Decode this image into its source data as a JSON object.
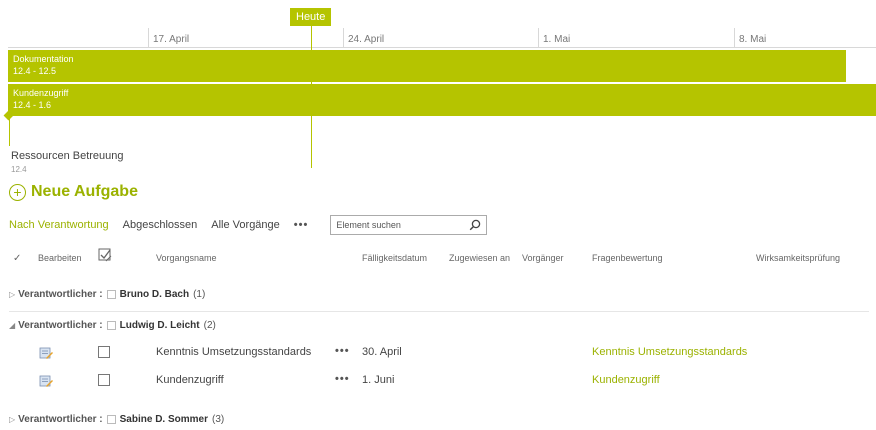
{
  "timeline": {
    "today_label": "Heute",
    "dates": [
      "17. April",
      "24. April",
      "1. Mai",
      "8. Mai"
    ],
    "bars": [
      {
        "name": "Dokumentation",
        "range": "12.4 - 12.5"
      },
      {
        "name": "Kundenzugriff",
        "range": "12.4 - 1.6"
      }
    ],
    "milestone": {
      "name": "Ressourcen Betreuung",
      "date": "12.4"
    },
    "accent_color": "#b5c400"
  },
  "new_task_label": "Neue Aufgabe",
  "views": {
    "tabs": [
      "Nach Verantwortung",
      "Abgeschlossen",
      "Alle Vorgänge"
    ],
    "more": "•••",
    "search_placeholder": "Element suchen"
  },
  "columns": {
    "check": "✓",
    "edit": "Bearbeiten",
    "name": "Vorgangsname",
    "due": "Fälligkeitsdatum",
    "assigned": "Zugewiesen an",
    "predecessor": "Vorgänger",
    "rating": "Fragenbewertung",
    "effectiveness": "Wirksamkeitsprüfung"
  },
  "groups": [
    {
      "label": "Verantwortlicher :",
      "name": "Bruno D. Bach",
      "count": "(1)",
      "expanded": false
    },
    {
      "label": "Verantwortlicher :",
      "name": "Ludwig D. Leicht",
      "count": "(2)",
      "expanded": true
    },
    {
      "label": "Verantwortlicher :",
      "name": "Sabine D. Sommer",
      "count": "(3)",
      "expanded": false
    }
  ],
  "rows": [
    {
      "name": "Kenntnis Umsetzungsstandards",
      "menu": "•••",
      "due": "30. April",
      "rating": "Kenntnis Umsetzungsstandards"
    },
    {
      "name": "Kundenzugriff",
      "menu": "•••",
      "due": "1. Juni",
      "rating": "Kundenzugriff"
    }
  ]
}
